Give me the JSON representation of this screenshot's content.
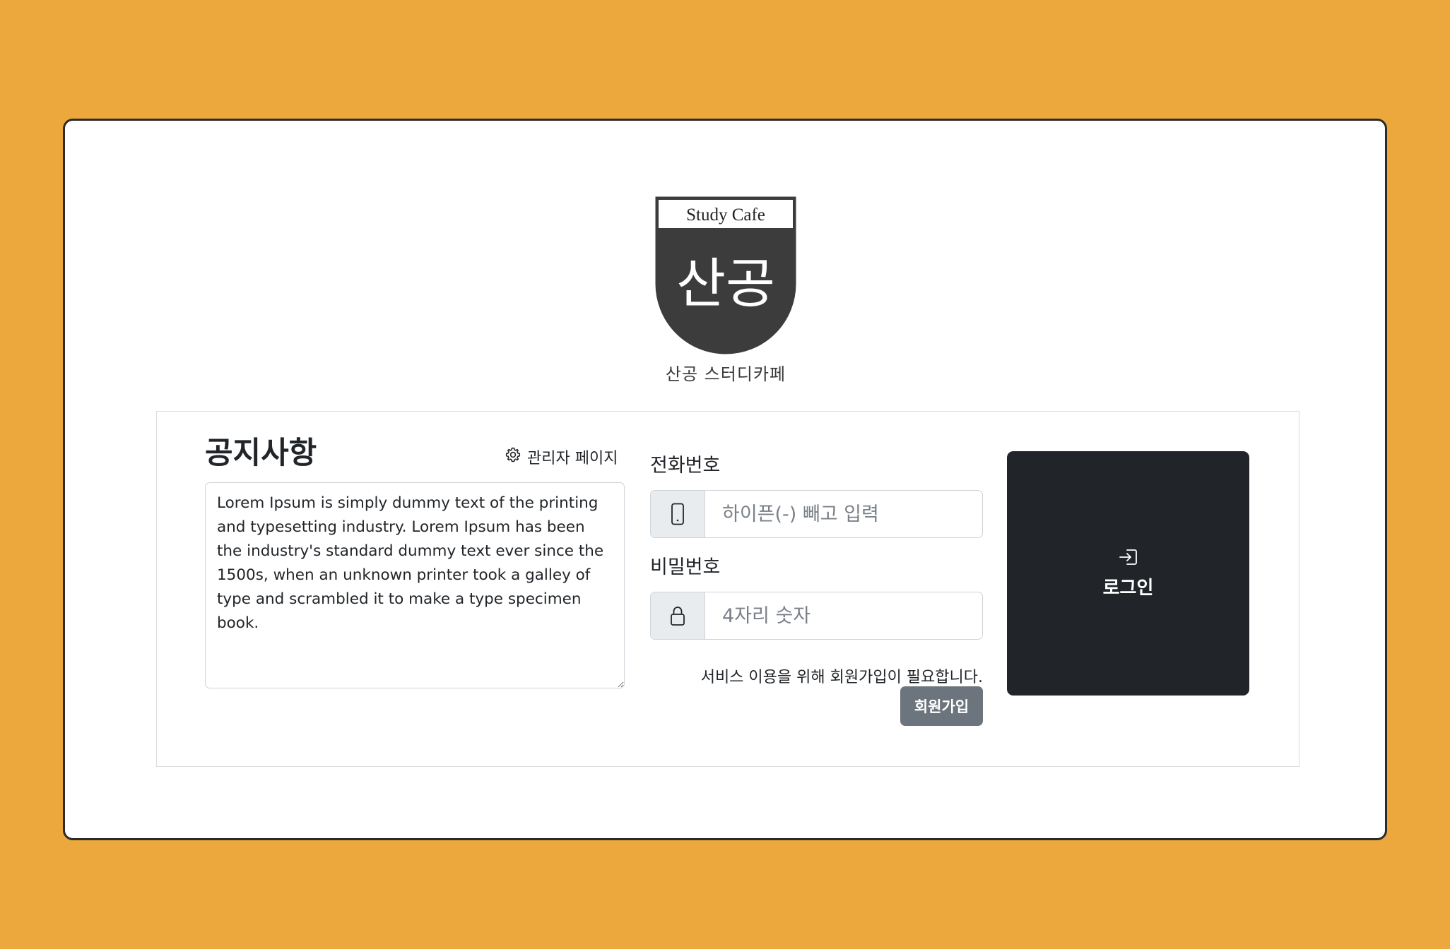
{
  "logo": {
    "top_text": "Study Cafe",
    "main_text": "산공",
    "caption": "산공 스터디카페"
  },
  "notice": {
    "title": "공지사항",
    "admin_link_label": "관리자 페이지",
    "admin_icon": "gear-icon",
    "content": "Lorem Ipsum is simply dummy text of the printing and typesetting industry. Lorem Ipsum has been the industry's standard dummy text ever since the 1500s, when an unknown printer took a galley of type and scrambled it to make a type specimen book."
  },
  "phone": {
    "label": "전화번호",
    "placeholder": "하이픈(-) 빼고 입력",
    "value": "",
    "icon": "phone-icon"
  },
  "password": {
    "label": "비밀번호",
    "placeholder": "4자리 숫자",
    "value": "",
    "icon": "lock-icon"
  },
  "signup": {
    "note": "서비스 이용을 위해 회원가입이 필요합니다.",
    "button_label": "회원가입"
  },
  "login": {
    "button_label": "로그인",
    "icon": "login-icon"
  },
  "colors": {
    "background": "#eca83c",
    "dark": "#212529",
    "logo_dark": "#3c3c3c",
    "secondary": "#6c757d",
    "addon_bg": "#e9ecef"
  }
}
